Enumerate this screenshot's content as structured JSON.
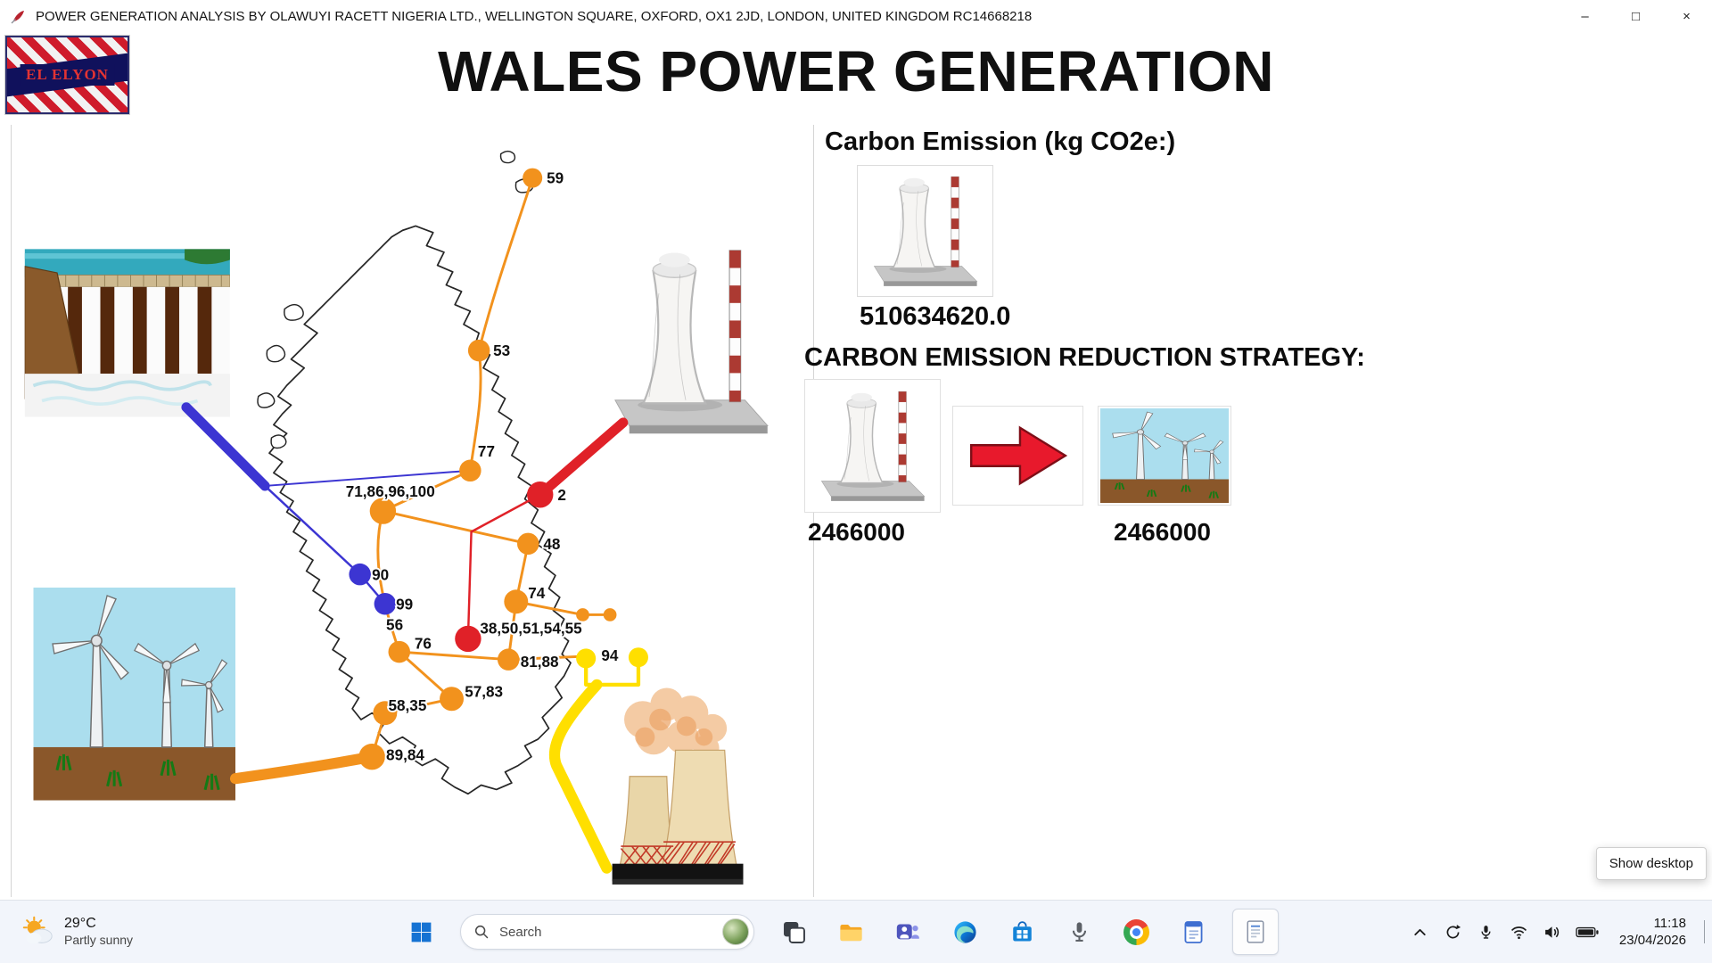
{
  "window": {
    "title": "POWER GENERATION ANALYSIS BY OLAWUYI RACETT NIGERIA LTD., WELLINGTON SQUARE, OXFORD, OX1 2JD, LONDON, UNITED KINGDOM RC14668218",
    "controls": {
      "minimize": "–",
      "maximize": "□",
      "close": "×"
    }
  },
  "header": {
    "logo_text": "EL ELYON",
    "title": "WALES POWER GENERATION"
  },
  "map": {
    "colors": {
      "orange": "#f2921d",
      "blue": "#3c35d2",
      "red": "#e02128",
      "yellow": "#ffdf00"
    },
    "nodes": [
      {
        "label": "59",
        "type": "orange"
      },
      {
        "label": "53",
        "type": "orange"
      },
      {
        "label": "77",
        "type": "orange"
      },
      {
        "label": "71,86,96,100",
        "type": "orange"
      },
      {
        "label": "2",
        "type": "red"
      },
      {
        "label": "48",
        "type": "orange"
      },
      {
        "label": "90",
        "type": "blue"
      },
      {
        "label": "99",
        "type": "blue"
      },
      {
        "label": "74",
        "type": "orange"
      },
      {
        "label": "56",
        "type": "orange"
      },
      {
        "label": "76",
        "type": "orange"
      },
      {
        "label": "38,50,51,54,55",
        "type": "red"
      },
      {
        "label": "81,88",
        "type": "orange"
      },
      {
        "label": "94",
        "type": "yellow"
      },
      {
        "label": "57,83",
        "type": "orange"
      },
      {
        "label": "58,35",
        "type": "orange"
      },
      {
        "label": "89,84",
        "type": "orange"
      }
    ]
  },
  "carbon": {
    "heading": "Carbon Emission (kg CO2e:)",
    "total": "510634620.0",
    "strategy_heading": "CARBON EMISSION REDUCTION STRATEGY:",
    "before": "2466000",
    "after": "2466000"
  },
  "taskbar": {
    "weather": {
      "temperature": "29°C",
      "condition": "Partly sunny"
    },
    "search": {
      "placeholder": "Search"
    },
    "tray": {
      "time": "11:18",
      "date": "23/04/2026"
    },
    "show_desktop": "Show desktop"
  }
}
